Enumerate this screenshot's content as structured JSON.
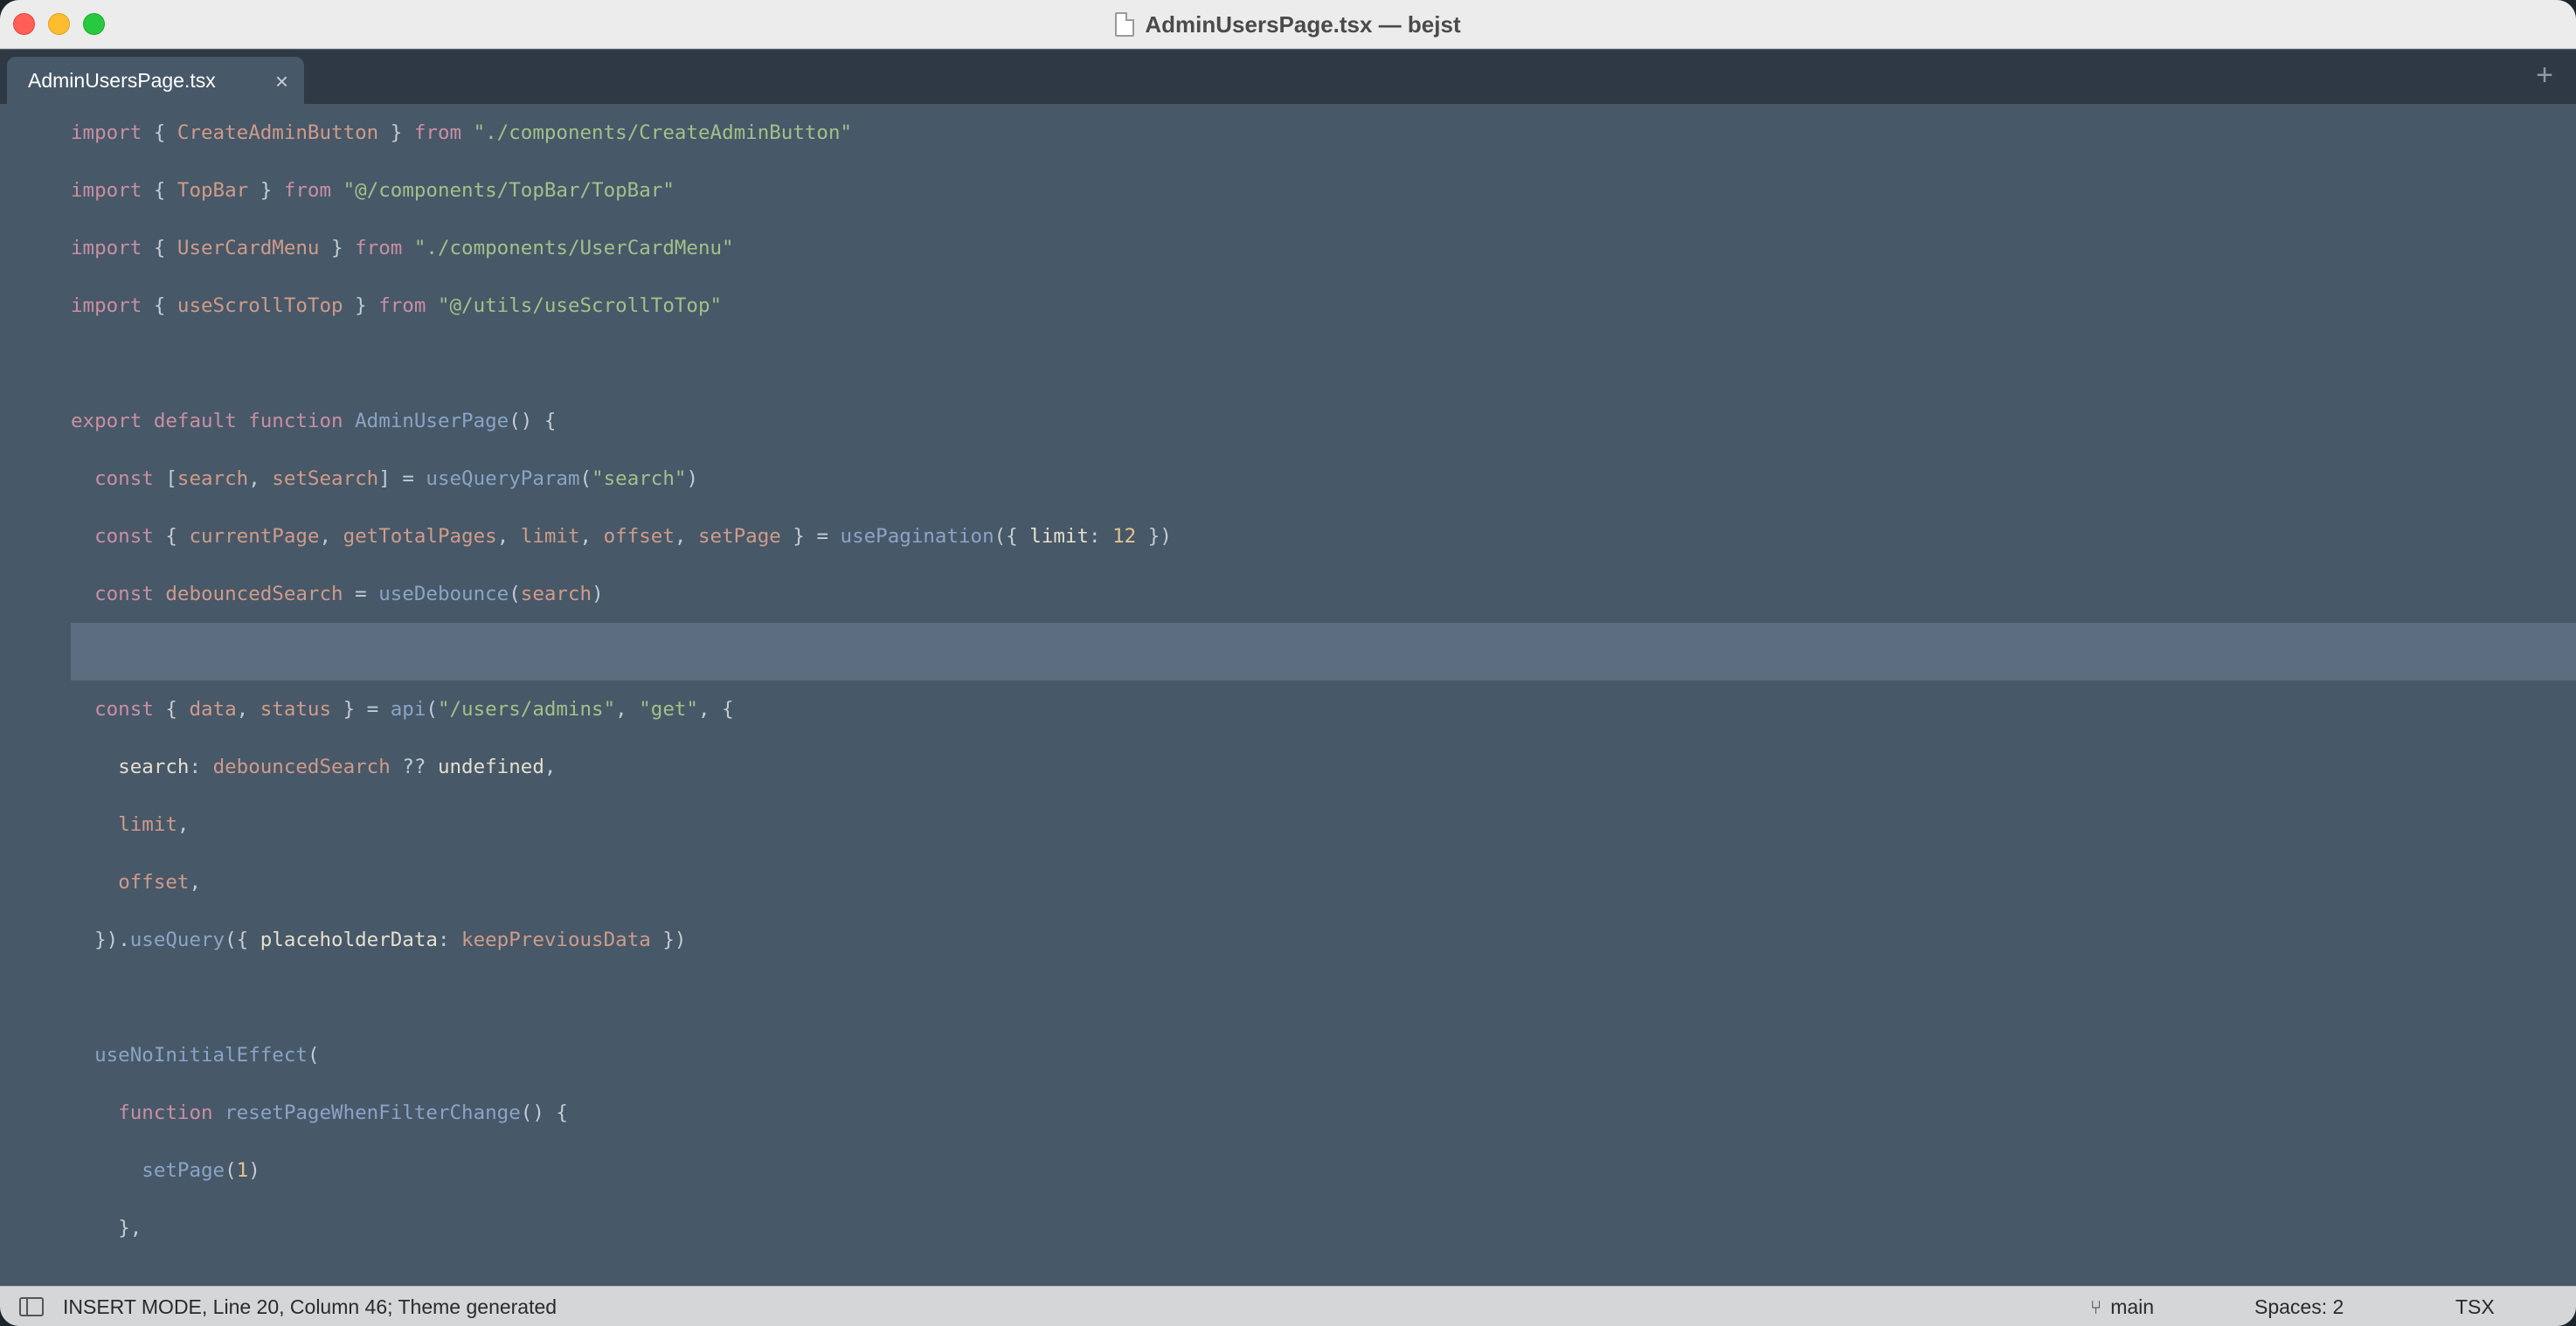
{
  "window": {
    "title": "AdminUsersPage.tsx — bejst"
  },
  "tabs": [
    {
      "label": "AdminUsersPage.tsx",
      "close_icon": "×"
    }
  ],
  "new_tab_icon": "+",
  "editor": {
    "active_line": 9,
    "lines": [
      "import { CreateAdminButton } from \"./components/CreateAdminButton\"",
      "import { TopBar } from \"@/components/TopBar/TopBar\"",
      "import { UserCardMenu } from \"./components/UserCardMenu\"",
      "import { useScrollToTop } from \"@/utils/useScrollToTop\"",
      "",
      "export default function AdminUserPage() {",
      "  const [search, setSearch] = useQueryParam(\"search\")",
      "  const { currentPage, getTotalPages, limit, offset, setPage } = usePagination({ limit: 12 })",
      "  const debouncedSearch = useDebounce(search)",
      "",
      "  const { data, status } = api(\"/users/admins\", \"get\", {",
      "    search: debouncedSearch ?? undefined,",
      "    limit,",
      "    offset,",
      "  }).useQuery({ placeholderData: keepPreviousData })",
      "",
      "  useNoInitialEffect(",
      "    function resetPageWhenFilterChange() {",
      "      setPage(1)",
      "    },"
    ]
  },
  "statusbar": {
    "mode": "INSERT MODE, Line 20, Column 46; Theme generated",
    "branch": "main",
    "spaces": "Spaces: 2",
    "syntax": "TSX"
  },
  "colors": {
    "editor_bg": "#475868",
    "active_line_bg": "#5b6d7e",
    "tabbar_bg": "#2f3944",
    "keyword": "#c98fa3",
    "identifier": "#cf9b8a",
    "function": "#8aa4c6",
    "string": "#a4c089",
    "number": "#e2c391"
  }
}
